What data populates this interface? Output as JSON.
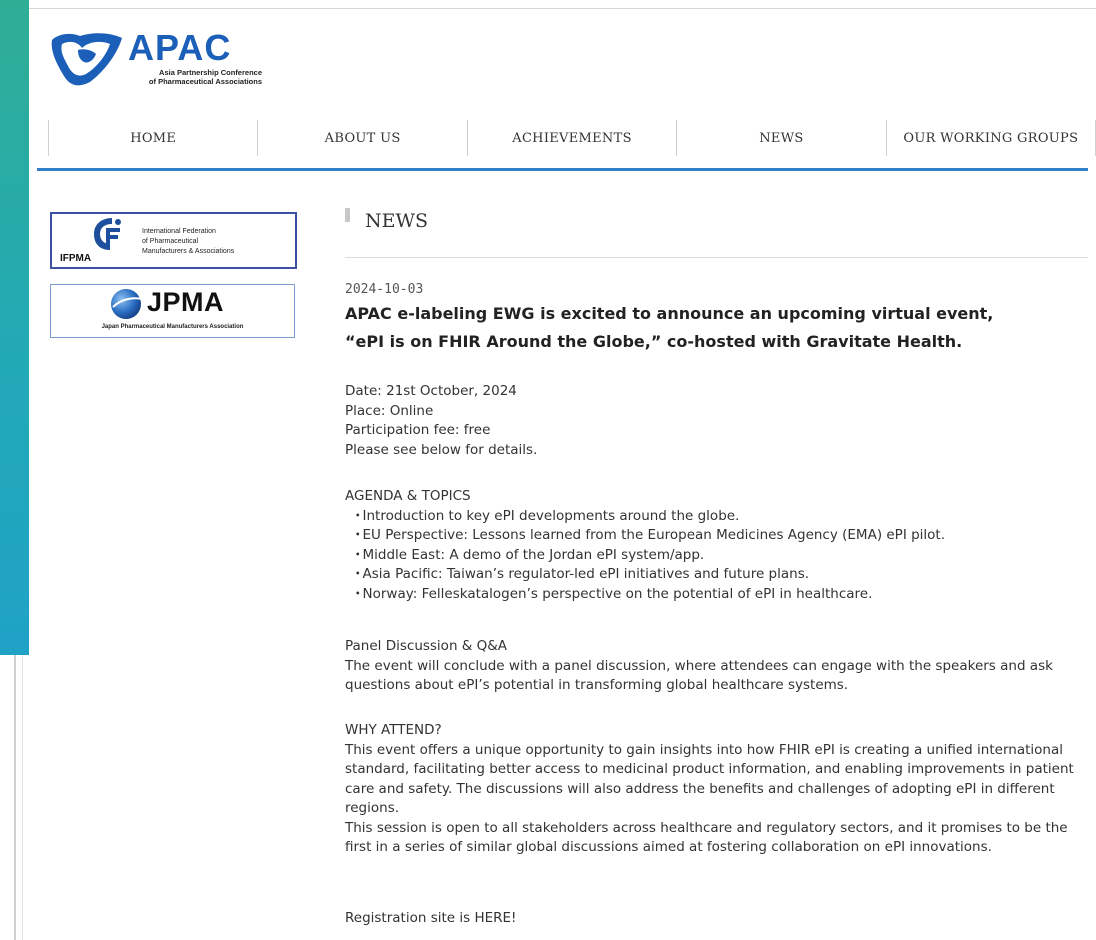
{
  "brand": {
    "logo_word": "APAC",
    "logo_subtitle_line1": "Asia Partnership Conference",
    "logo_subtitle_line2": "of Pharmaceutical Associations",
    "blue": "#1c5fb8",
    "accent_line": "#2f7fc9",
    "side_band": "#22a9b6"
  },
  "nav": {
    "items": [
      {
        "label": "HOME"
      },
      {
        "label": "ABOUT US"
      },
      {
        "label": "ACHIEVEMENTS"
      },
      {
        "label": "NEWS"
      },
      {
        "label": "OUR WORKING GROUPS"
      }
    ]
  },
  "sidebar": {
    "ifpma": {
      "abbr": "IFPMA",
      "line1": "International Federation",
      "line2": "of Pharmaceutical",
      "line3": "Manufacturers & Associations"
    },
    "jpma": {
      "abbr": "JPMA",
      "subtitle": "Japan Pharmaceutical Manufacturers Association"
    }
  },
  "news": {
    "heading": "NEWS",
    "date": "2024-10-03",
    "title_line1": "APAC e-labeling EWG is excited to announce an upcoming virtual event,",
    "title_line2": "“ePI is on FHIR Around the Globe,” co-hosted with Gravitate Health.",
    "details": [
      "Date: 21st October, 2024",
      "Place: Online",
      "Participation fee: free",
      "Please see below for details."
    ],
    "agenda_heading": "AGENDA & TOPICS",
    "agenda_items": [
      "Introduction to key ePI developments around the globe.",
      "EU Perspective: Lessons learned from the European Medicines Agency (EMA) ePI pilot.",
      "Middle East: A demo of the Jordan ePI system/app.",
      "Asia Pacific: Taiwan’s regulator-led ePI initiatives and future plans.",
      "Norway: Felleskatalogen’s perspective on the potential of ePI in healthcare."
    ],
    "panel_heading": "Panel Discussion & Q&A",
    "panel_text": "The event will conclude with a panel discussion, where attendees can engage with the speakers and ask questions about ePI’s potential in transforming global healthcare systems.",
    "why_heading": "WHY ATTEND?",
    "why_text_1": "This event offers a unique opportunity to gain insights into how FHIR ePI is creating a unified international standard, facilitating better access to medicinal product information, and enabling improvements in patient care and safety. The discussions will also address the benefits and challenges of adopting ePI in different regions.",
    "why_text_2": "This session is open to all stakeholders across healthcare and regulatory sectors, and it promises to be the first in a series of similar global discussions aimed at fostering collaboration on ePI innovations.",
    "registration": "Registration site is HERE!"
  }
}
